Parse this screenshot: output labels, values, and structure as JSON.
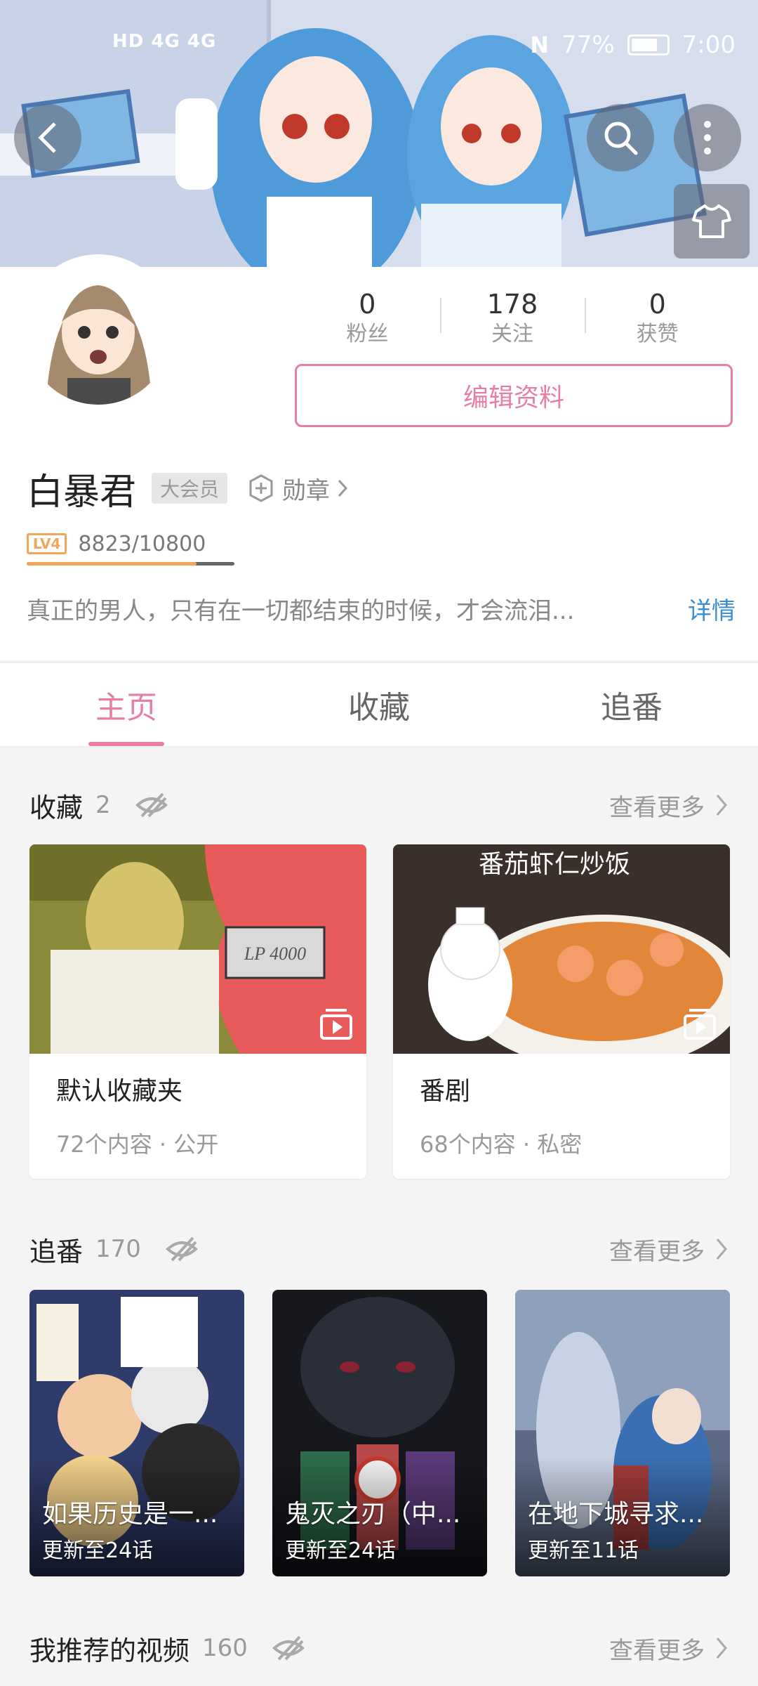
{
  "status_bar": {
    "left_text": "HD 4G 4G",
    "battery_percent": "77%",
    "time": "7:00"
  },
  "header_icons": [
    "back-icon",
    "search-icon",
    "more-icon",
    "tshirt-icon"
  ],
  "profile": {
    "stats": [
      {
        "value": "0",
        "label": "粉丝"
      },
      {
        "value": "178",
        "label": "关注"
      },
      {
        "value": "0",
        "label": "获赞"
      }
    ],
    "edit_label": "编辑资料",
    "username": "白暴君",
    "vip_badge": "大会员",
    "medal_label": "勋章",
    "level_badge": "LV4",
    "exp_text": "8823/10800",
    "exp_fraction": 0.817,
    "bio": "真正的男人，只有在一切都结束的时候，才会流泪...",
    "details_label": "详情"
  },
  "tabs": [
    {
      "label": "主页",
      "active": true
    },
    {
      "label": "收藏",
      "active": false
    },
    {
      "label": "追番",
      "active": false
    }
  ],
  "favorites": {
    "title": "收藏",
    "count": "2",
    "see_more": "查看更多",
    "items": [
      {
        "name": "默认收藏夹",
        "meta": "72个内容 · 公开",
        "thumb_text": "LP 4000"
      },
      {
        "name": "番剧",
        "meta": "68个内容 · 私密",
        "thumb_text": "番茄虾仁炒饭"
      }
    ]
  },
  "bangumi": {
    "title": "追番",
    "count": "170",
    "see_more": "查看更多",
    "items": [
      {
        "title": "如果历史是一...",
        "update": "更新至24话"
      },
      {
        "title": "鬼灭之刃（中...",
        "update": "更新至24话"
      },
      {
        "title": "在地下城寻求...",
        "update": "更新至11话"
      }
    ]
  },
  "recommended": {
    "title": "我推荐的视频",
    "count": "160",
    "see_more": "查看更多"
  },
  "colors": {
    "accent_pink": "#e67fa2",
    "link_blue": "#3b8fd0",
    "level_orange": "#f2a65a"
  }
}
